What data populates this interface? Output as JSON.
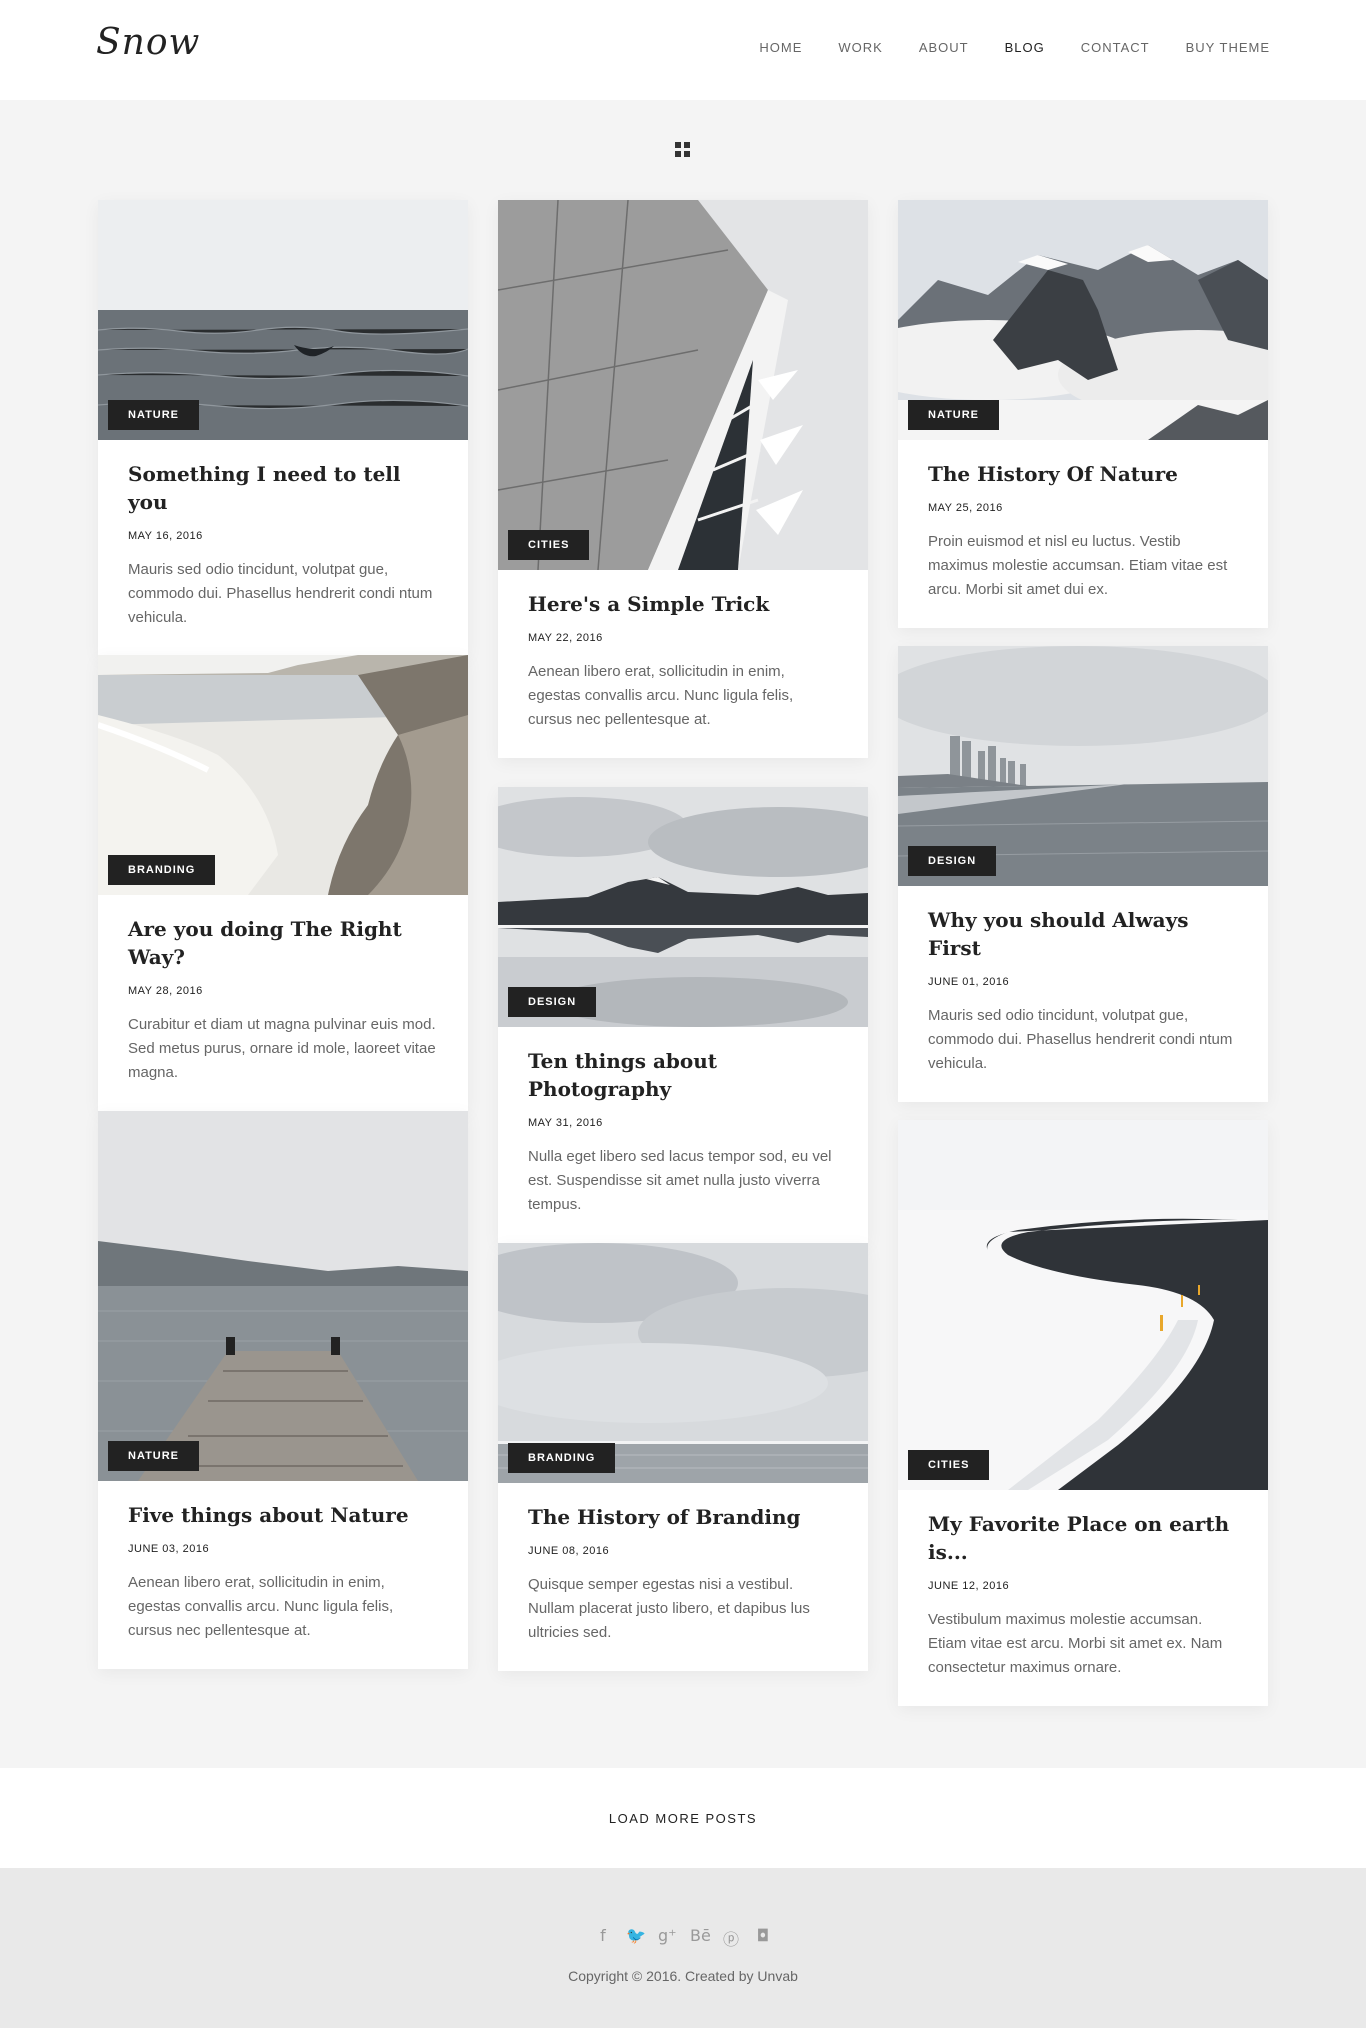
{
  "header": {
    "logo": "Snow",
    "nav": [
      {
        "label": "HOME",
        "active": false
      },
      {
        "label": "WORK",
        "active": false
      },
      {
        "label": "ABOUT",
        "active": false
      },
      {
        "label": "BLOG",
        "active": true
      },
      {
        "label": "CONTACT",
        "active": false
      },
      {
        "label": "BUY THEME",
        "active": false
      }
    ]
  },
  "posts": [
    {
      "category": "NATURE",
      "title": "Something I need to tell you",
      "date": "MAY 16, 2016",
      "excerpt": "Mauris sed odio tincidunt, volutpat gue, commodo dui. Phasellus hendrerit condi ntum vehicula."
    },
    {
      "category": "CITIES",
      "title": "Here's a Simple Trick",
      "date": "MAY 22, 2016",
      "excerpt": "Aenean libero erat, sollicitudin in enim, egestas convallis arcu. Nunc ligula felis, cursus nec pellentesque at."
    },
    {
      "category": "NATURE",
      "title": "The History Of Nature",
      "date": "MAY 25, 2016",
      "excerpt": "Proin euismod et nisl eu luctus. Vestib maximus molestie accumsan. Etiam vitae est arcu. Morbi sit amet dui ex."
    },
    {
      "category": "BRANDING",
      "title": "Are you doing The Right Way?",
      "date": "MAY 28, 2016",
      "excerpt": "Curabitur et diam ut magna pulvinar euis mod. Sed metus purus, ornare id mole, laoreet vitae magna."
    },
    {
      "category": "DESIGN",
      "title": "Ten things about Photography",
      "date": "MAY 31, 2016",
      "excerpt": "Nulla eget libero sed lacus tempor sod, eu vel est. Suspendisse sit amet nulla justo viverra tempus."
    },
    {
      "category": "DESIGN",
      "title": "Why you should Always First",
      "date": "JUNE 01, 2016",
      "excerpt": "Mauris sed odio tincidunt, volutpat gue, commodo dui. Phasellus hendrerit condi ntum vehicula."
    },
    {
      "category": "NATURE",
      "title": "Five things about Nature",
      "date": "JUNE 03, 2016",
      "excerpt": "Aenean libero erat, sollicitudin in enim, egestas convallis arcu. Nunc ligula felis, cursus nec pellentesque at."
    },
    {
      "category": "BRANDING",
      "title": "The History of Branding",
      "date": "JUNE 08, 2016",
      "excerpt": "Quisque semper egestas nisi a vestibul. Nullam placerat justo libero, et dapibus lus ultricies sed."
    },
    {
      "category": "CITIES",
      "title": "My Favorite Place on earth is...",
      "date": "JUNE 12, 2016",
      "excerpt": "Vestibulum maximus molestie accumsan. Etiam vitae est arcu. Morbi sit amet ex. Nam consectetur maximus ornare."
    }
  ],
  "load_more": "LOAD MORE POSTS",
  "footer": {
    "social": [
      {
        "icon": "facebook-icon",
        "glyph": "f"
      },
      {
        "icon": "twitter-icon",
        "glyph": "🐦"
      },
      {
        "icon": "google-plus-icon",
        "glyph": "g⁺"
      },
      {
        "icon": "behance-icon",
        "glyph": "Bē"
      },
      {
        "icon": "pinterest-icon",
        "glyph": "ⓟ"
      },
      {
        "icon": "instagram-icon",
        "glyph": "◘"
      }
    ],
    "copyright": "Copyright © 2016. Created by Unvab"
  }
}
